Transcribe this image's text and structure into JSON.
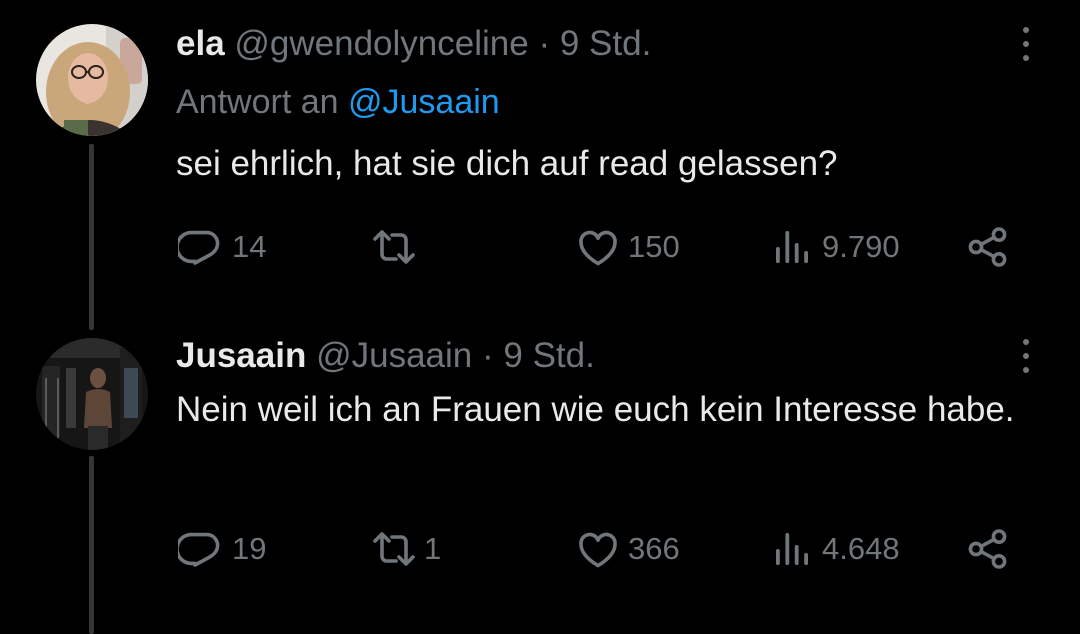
{
  "colors": {
    "background": "#000000",
    "text_primary": "#e7e9ea",
    "text_secondary": "#71767b",
    "link": "#1d9bf0",
    "thread_line": "#333639"
  },
  "tweets": [
    {
      "display_name": "ela",
      "handle": "@gwendolynceline",
      "separator": "·",
      "time": "9 Std.",
      "replying_to": {
        "prefix": "Antwort an",
        "mention": "@Jusaain"
      },
      "text": "sei ehrlich, hat sie dich auf read gelassen?",
      "actions": {
        "replies": "14",
        "retweets": "",
        "likes": "150",
        "views": "9.790"
      },
      "icons": {
        "more": "more-vertical-icon",
        "reply": "reply-icon",
        "retweet": "retweet-icon",
        "like": "heart-icon",
        "views": "views-icon",
        "share": "share-icon"
      }
    },
    {
      "display_name": "Jusaain",
      "handle": "@Jusaain",
      "separator": "·",
      "time": "9 Std.",
      "text": "Nein weil ich an Frauen wie euch kein Interesse habe.",
      "actions": {
        "replies": "19",
        "retweets": "1",
        "likes": "366",
        "views": "4.648"
      },
      "icons": {
        "more": "more-vertical-icon",
        "reply": "reply-icon",
        "retweet": "retweet-icon",
        "like": "heart-icon",
        "views": "views-icon",
        "share": "share-icon"
      }
    }
  ]
}
